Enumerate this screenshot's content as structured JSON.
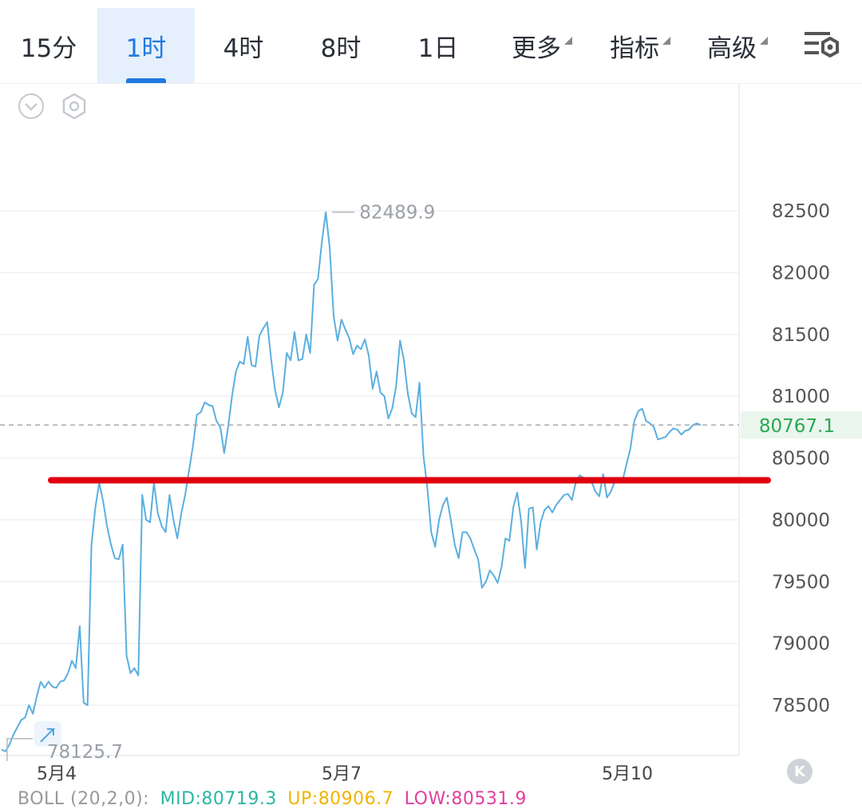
{
  "toolbar": {
    "tabs": [
      {
        "label": "15分",
        "active": false,
        "dropdown": false
      },
      {
        "label": "1时",
        "active": true,
        "dropdown": false
      },
      {
        "label": "4时",
        "active": false,
        "dropdown": false
      },
      {
        "label": "8时",
        "active": false,
        "dropdown": false
      },
      {
        "label": "1日",
        "active": false,
        "dropdown": false
      },
      {
        "label": "更多",
        "active": false,
        "dropdown": true
      },
      {
        "label": "指标",
        "active": false,
        "dropdown": true
      },
      {
        "label": "高级",
        "active": false,
        "dropdown": true
      }
    ],
    "settings_icon": "chart-settings-icon",
    "accent_color": "#1f7ae0"
  },
  "chart_tools": [
    "collapse-chevron-icon",
    "hexagon-settings-icon"
  ],
  "chart_data": {
    "type": "line",
    "y_ticks": [
      82500,
      82000,
      81500,
      81000,
      80500,
      80000,
      79500,
      79000,
      78500
    ],
    "ylim": [
      78100,
      82900
    ],
    "x_labels": [
      "5月4",
      "5月7",
      "5月10"
    ],
    "current_price": "80767.1",
    "current_price_value": 80767.1,
    "high_label": "82489.9",
    "high_value": 82489.9,
    "low_label": "78125.7",
    "low_value": 78125.7,
    "annotation_line_value": 80320,
    "annotation_line_color": "#e0000f",
    "line_color": "#5aafe0",
    "price_color": "#2aa750",
    "series": [
      {
        "values": [
          78140,
          78125.7,
          78180,
          78260,
          78320,
          78380,
          78400,
          78500,
          78430,
          78570,
          78690,
          78640,
          78690,
          78650,
          78640,
          78690,
          78700,
          78760,
          78860,
          78800,
          79140,
          78520,
          78500,
          79800,
          80100,
          80300,
          80150,
          79950,
          79800,
          79690,
          79680,
          79800,
          78900,
          78760,
          78800,
          78740,
          80200,
          80000,
          79980,
          80300,
          80050,
          79950,
          79900,
          80200,
          80000,
          79850,
          80050,
          80200,
          80400,
          80600,
          80850,
          80870,
          80950,
          80930,
          80920,
          80800,
          80750,
          80540,
          80750,
          81000,
          81200,
          81280,
          81260,
          81480,
          81250,
          81240,
          81490,
          81550,
          81600,
          81300,
          81050,
          80910,
          81030,
          81350,
          81290,
          81520,
          81290,
          81300,
          81500,
          81350,
          81900,
          81950,
          82250,
          82489.9,
          82200,
          81650,
          81450,
          81620,
          81540,
          81470,
          81340,
          81410,
          81380,
          81460,
          81330,
          81060,
          81200,
          81030,
          81000,
          80820,
          80900,
          81080,
          81450,
          81290,
          81020,
          80860,
          80830,
          81110,
          80520,
          80260,
          79900,
          79780,
          80000,
          80120,
          80180,
          80000,
          79800,
          79690,
          79900,
          79900,
          79850,
          79760,
          79680,
          79450,
          79500,
          79590,
          79550,
          79490,
          79620,
          79850,
          79830,
          80100,
          80220,
          79990,
          79610,
          80090,
          80100,
          79760,
          79980,
          80080,
          80110,
          80060,
          80120,
          80160,
          80200,
          80210,
          80160,
          80300,
          80360,
          80340,
          80330,
          80310,
          80230,
          80190,
          80370,
          80180,
          80230,
          80310,
          80330,
          80320,
          80450,
          80580,
          80800,
          80880,
          80900,
          80800,
          80780,
          80750,
          80650,
          80660,
          80670,
          80710,
          80740,
          80730,
          80690,
          80720,
          80730,
          80767.1,
          80780,
          80767.1
        ]
      }
    ]
  },
  "k_button_label": "K",
  "boll": {
    "label": "BOLL (20,2,0):",
    "mid": "MID:80719.3",
    "up": "UP:80906.7",
    "low": "LOW:80531.9",
    "colors": {
      "label": "#999999",
      "mid": "#2ab6a3",
      "up": "#f0b400",
      "low": "#e040a0"
    }
  }
}
